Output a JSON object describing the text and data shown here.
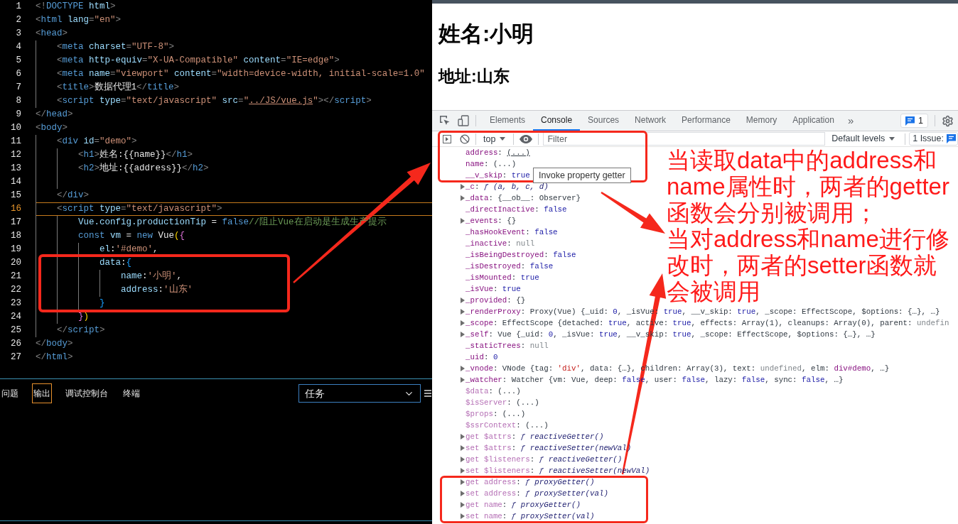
{
  "editor": {
    "lines": [
      {
        "number": "1",
        "current": false,
        "tokens": [
          {
            "text": "<!",
            "kind": "punct"
          },
          {
            "text": "DOCTYPE",
            "kind": "tag"
          },
          {
            "text": " html",
            "kind": "attr"
          },
          {
            "text": ">",
            "kind": "punct"
          }
        ]
      },
      {
        "number": "2",
        "current": false,
        "tokens": [
          {
            "text": "<",
            "kind": "punct"
          },
          {
            "text": "html",
            "kind": "tag"
          },
          {
            "text": " lang",
            "kind": "attr"
          },
          {
            "text": "=",
            "kind": "punct"
          },
          {
            "text": "\"en\"",
            "kind": "string"
          },
          {
            "text": ">",
            "kind": "punct"
          }
        ]
      },
      {
        "number": "3",
        "current": false,
        "tokens": [
          {
            "text": "<",
            "kind": "punct"
          },
          {
            "text": "head",
            "kind": "tag"
          },
          {
            "text": ">",
            "kind": "punct"
          }
        ],
        "children": [
          {
            "number": "4",
            "current": false,
            "tokens": [
              {
                "text": "<",
                "kind": "punct"
              },
              {
                "text": "meta",
                "kind": "tag"
              },
              {
                "text": " charset",
                "kind": "attr"
              },
              {
                "text": "=",
                "kind": "punct"
              },
              {
                "text": "\"UTF-8\"",
                "kind": "string"
              },
              {
                "text": ">",
                "kind": "punct"
              }
            ]
          },
          {
            "number": "5",
            "current": false,
            "tokens": [
              {
                "text": "<",
                "kind": "punct"
              },
              {
                "text": "meta",
                "kind": "tag"
              },
              {
                "text": " http-equiv",
                "kind": "attr"
              },
              {
                "text": "=",
                "kind": "punct"
              },
              {
                "text": "\"X-UA-Compatible\"",
                "kind": "string"
              },
              {
                "text": " content",
                "kind": "attr"
              },
              {
                "text": "=",
                "kind": "punct"
              },
              {
                "text": "\"IE=edge\"",
                "kind": "string"
              },
              {
                "text": ">",
                "kind": "punct"
              }
            ]
          },
          {
            "number": "6",
            "current": false,
            "tokens": [
              {
                "text": "<",
                "kind": "punct"
              },
              {
                "text": "meta",
                "kind": "tag"
              },
              {
                "text": " name",
                "kind": "attr"
              },
              {
                "text": "=",
                "kind": "punct"
              },
              {
                "text": "\"viewport\"",
                "kind": "string"
              },
              {
                "text": " content",
                "kind": "attr"
              },
              {
                "text": "=",
                "kind": "punct"
              },
              {
                "text": "\"width=device-width, initial-scale=1.0\"",
                "kind": "string"
              }
            ]
          },
          {
            "number": "7",
            "current": false,
            "tokens": [
              {
                "text": "<",
                "kind": "punct"
              },
              {
                "text": "title",
                "kind": "tag"
              },
              {
                "text": ">",
                "kind": "punct"
              },
              {
                "text": "数据代理1",
                "kind": "text"
              },
              {
                "text": "</",
                "kind": "punct"
              },
              {
                "text": "title",
                "kind": "tag"
              },
              {
                "text": ">",
                "kind": "punct"
              }
            ]
          },
          {
            "number": "8",
            "current": false,
            "tokens": [
              {
                "text": "<",
                "kind": "punct"
              },
              {
                "text": "script",
                "kind": "tag"
              },
              {
                "text": " type",
                "kind": "attr"
              },
              {
                "text": "=",
                "kind": "punct"
              },
              {
                "text": "\"text/javascript\"",
                "kind": "string"
              },
              {
                "text": " src",
                "kind": "attr"
              },
              {
                "text": "=",
                "kind": "punct"
              },
              {
                "text": "\"",
                "kind": "string"
              },
              {
                "text": "../JS/vue.js",
                "kind": "link"
              },
              {
                "text": "\"",
                "kind": "string"
              },
              {
                "text": "></",
                "kind": "punct"
              },
              {
                "text": "script",
                "kind": "tag"
              },
              {
                "text": ">",
                "kind": "punct"
              }
            ]
          }
        ]
      },
      {
        "number": "9",
        "current": false,
        "tokens": [
          {
            "text": "</",
            "kind": "punct"
          },
          {
            "text": "head",
            "kind": "tag"
          },
          {
            "text": ">",
            "kind": "punct"
          }
        ]
      },
      {
        "number": "10",
        "current": false,
        "tokens": [
          {
            "text": "<",
            "kind": "punct"
          },
          {
            "text": "body",
            "kind": "tag"
          },
          {
            "text": ">",
            "kind": "punct"
          }
        ],
        "children": [
          {
            "number": "11",
            "current": false,
            "tokens": [
              {
                "text": "<",
                "kind": "punct"
              },
              {
                "text": "div",
                "kind": "tag"
              },
              {
                "text": " id",
                "kind": "attr"
              },
              {
                "text": "=",
                "kind": "punct"
              },
              {
                "text": "\"demo\"",
                "kind": "string"
              },
              {
                "text": ">",
                "kind": "punct"
              }
            ],
            "children": [
              {
                "number": "12",
                "current": false,
                "tokens": [
                  {
                    "text": "<",
                    "kind": "punct"
                  },
                  {
                    "text": "h1",
                    "kind": "tag"
                  },
                  {
                    "text": ">",
                    "kind": "punct"
                  },
                  {
                    "text": "姓名:{{name}}",
                    "kind": "text"
                  },
                  {
                    "text": "</",
                    "kind": "punct"
                  },
                  {
                    "text": "h1",
                    "kind": "tag"
                  },
                  {
                    "text": ">",
                    "kind": "punct"
                  }
                ]
              },
              {
                "number": "13",
                "current": false,
                "tokens": [
                  {
                    "text": "<",
                    "kind": "punct"
                  },
                  {
                    "text": "h2",
                    "kind": "tag"
                  },
                  {
                    "text": ">",
                    "kind": "punct"
                  },
                  {
                    "text": "地址:{{address}}",
                    "kind": "text"
                  },
                  {
                    "text": "</",
                    "kind": "punct"
                  },
                  {
                    "text": "h2",
                    "kind": "tag"
                  },
                  {
                    "text": ">",
                    "kind": "punct"
                  }
                ]
              },
              {
                "number": "14",
                "current": false
              }
            ]
          },
          {
            "number": "15",
            "current": false,
            "tokens": [
              {
                "text": "</",
                "kind": "punct"
              },
              {
                "text": "div",
                "kind": "tag"
              },
              {
                "text": ">",
                "kind": "punct"
              }
            ]
          },
          {
            "number": "16",
            "current": true,
            "tokens": [
              {
                "text": "<",
                "kind": "punct"
              },
              {
                "text": "script",
                "kind": "tag"
              },
              {
                "text": " type",
                "kind": "attr"
              },
              {
                "text": "=",
                "kind": "punct"
              },
              {
                "text": "\"text/javascript\"",
                "kind": "string"
              },
              {
                "text": ">",
                "kind": "punct"
              }
            ],
            "children": [
              {
                "number": "17",
                "current": false,
                "tokens": [
                  {
                    "text": "Vue.config.productionTip",
                    "kind": "variable"
                  },
                  {
                    "text": " = ",
                    "kind": "text"
                  },
                  {
                    "text": "false",
                    "kind": "keyword"
                  },
                  {
                    "text": "//阻止Vue在启动是生成生产提示",
                    "kind": "comment"
                  }
                ]
              },
              {
                "number": "18",
                "current": false,
                "tokens": [
                  {
                    "text": "const",
                    "kind": "keyword"
                  },
                  {
                    "text": " vm",
                    "kind": "variable"
                  },
                  {
                    "text": " = ",
                    "kind": "text"
                  },
                  {
                    "text": "new",
                    "kind": "keyword"
                  },
                  {
                    "text": " Vue",
                    "kind": "text"
                  },
                  {
                    "text": "(",
                    "kind": "bracket-gold"
                  },
                  {
                    "text": "{",
                    "kind": "bracket-pink"
                  }
                ],
                "children": [
                  {
                    "number": "19",
                    "current": false,
                    "tokens": [
                      {
                        "text": "el",
                        "kind": "variable"
                      },
                      {
                        "text": ":",
                        "kind": "text"
                      },
                      {
                        "text": "'#demo'",
                        "kind": "string"
                      },
                      {
                        "text": ",",
                        "kind": "text"
                      }
                    ]
                  },
                  {
                    "number": "20",
                    "current": false,
                    "tokens": [
                      {
                        "text": "data",
                        "kind": "variable"
                      },
                      {
                        "text": ":",
                        "kind": "text"
                      },
                      {
                        "text": "{",
                        "kind": "bracket-blue"
                      }
                    ],
                    "children": [
                      {
                        "number": "21",
                        "current": false,
                        "tokens": [
                          {
                            "text": "name",
                            "kind": "variable"
                          },
                          {
                            "text": ":",
                            "kind": "text"
                          },
                          {
                            "text": "'小明'",
                            "kind": "string"
                          },
                          {
                            "text": ",",
                            "kind": "text"
                          }
                        ]
                      },
                      {
                        "number": "22",
                        "current": false,
                        "tokens": [
                          {
                            "text": "address",
                            "kind": "variable"
                          },
                          {
                            "text": ":",
                            "kind": "text"
                          },
                          {
                            "text": "'山东'",
                            "kind": "string"
                          }
                        ]
                      }
                    ]
                  },
                  {
                    "number": "23",
                    "current": false,
                    "tokens": [
                      {
                        "text": "}",
                        "kind": "bracket-blue"
                      }
                    ]
                  }
                ]
              },
              {
                "number": "24",
                "current": false,
                "tokens": [
                  {
                    "text": "}",
                    "kind": "bracket-pink"
                  },
                  {
                    "text": ")",
                    "kind": "bracket-gold"
                  }
                ]
              }
            ]
          },
          {
            "number": "25",
            "current": false,
            "tokens": [
              {
                "text": "</",
                "kind": "punct"
              },
              {
                "text": "script",
                "kind": "tag"
              },
              {
                "text": ">",
                "kind": "punct"
              }
            ]
          }
        ]
      },
      {
        "number": "26",
        "current": false,
        "tokens": [
          {
            "text": "</",
            "kind": "punct"
          },
          {
            "text": "body",
            "kind": "tag"
          },
          {
            "text": ">",
            "kind": "punct"
          }
        ]
      },
      {
        "number": "27",
        "current": false,
        "tokens": [
          {
            "text": "</",
            "kind": "punct"
          },
          {
            "text": "html",
            "kind": "tag"
          },
          {
            "text": ">",
            "kind": "punct"
          }
        ]
      }
    ]
  },
  "bottom_panel": {
    "tabs": [
      {
        "label": "问题",
        "selected": false
      },
      {
        "label": "输出",
        "selected": true
      },
      {
        "label": "调试控制台",
        "selected": false
      },
      {
        "label": "终端",
        "selected": false
      }
    ],
    "dropdown": {
      "value": "任务"
    }
  },
  "browser": {
    "heading": "姓名:小明",
    "subheading": "地址:山东"
  },
  "devtools": {
    "tabs": [
      {
        "label": "Elements",
        "selected": false
      },
      {
        "label": "Console",
        "selected": true
      },
      {
        "label": "Sources",
        "selected": false
      },
      {
        "label": "Network",
        "selected": false
      },
      {
        "label": "Performance",
        "selected": false
      },
      {
        "label": "Memory",
        "selected": false
      },
      {
        "label": "Application",
        "selected": false
      }
    ],
    "more_tabs": "»",
    "issues_count": "1",
    "console_toolbar": {
      "context": "top",
      "filter": {
        "placeholder": "Filter"
      },
      "levels": "Default levels",
      "issues": "1 Issue:"
    },
    "rows": [
      {
        "expandable": false,
        "tokens": [
          {
            "text": "address",
            "kind": "key"
          },
          {
            "text": ": ",
            "kind": "plain"
          },
          {
            "text": "(...)",
            "kind": "hovered"
          }
        ]
      },
      {
        "expandable": false,
        "tokens": [
          {
            "text": "name",
            "kind": "key"
          },
          {
            "text": ": (...)",
            "kind": "plain"
          }
        ]
      },
      {
        "expandable": false,
        "tokens": [
          {
            "text": "__v_skip",
            "kind": "key"
          },
          {
            "text": ": ",
            "kind": "plain"
          },
          {
            "text": "true",
            "kind": "value"
          }
        ]
      },
      {
        "expandable": true,
        "tokens": [
          {
            "text": "_c",
            "kind": "key"
          },
          {
            "text": ": ",
            "kind": "plain"
          },
          {
            "text": "ƒ (a, b, c, d)",
            "kind": "func"
          }
        ]
      },
      {
        "expandable": true,
        "tokens": [
          {
            "text": "_data",
            "kind": "key"
          },
          {
            "text": ": {__ob__: Observer}",
            "kind": "plain"
          }
        ]
      },
      {
        "expandable": false,
        "tokens": [
          {
            "text": "_directInactive",
            "kind": "key"
          },
          {
            "text": ": ",
            "kind": "plain"
          },
          {
            "text": "false",
            "kind": "value"
          }
        ]
      },
      {
        "expandable": true,
        "tokens": [
          {
            "text": "_events",
            "kind": "key"
          },
          {
            "text": ": {}",
            "kind": "plain"
          }
        ]
      },
      {
        "expandable": false,
        "tokens": [
          {
            "text": "_hasHookEvent",
            "kind": "key"
          },
          {
            "text": ": ",
            "kind": "plain"
          },
          {
            "text": "false",
            "kind": "value"
          }
        ]
      },
      {
        "expandable": false,
        "tokens": [
          {
            "text": "_inactive",
            "kind": "key"
          },
          {
            "text": ": ",
            "kind": "plain"
          },
          {
            "text": "null",
            "kind": "null"
          }
        ]
      },
      {
        "expandable": false,
        "tokens": [
          {
            "text": "_isBeingDestroyed",
            "kind": "key"
          },
          {
            "text": ": ",
            "kind": "plain"
          },
          {
            "text": "false",
            "kind": "value"
          }
        ]
      },
      {
        "expandable": false,
        "tokens": [
          {
            "text": "_isDestroyed",
            "kind": "key"
          },
          {
            "text": ": ",
            "kind": "plain"
          },
          {
            "text": "false",
            "kind": "value"
          }
        ]
      },
      {
        "expandable": false,
        "tokens": [
          {
            "text": "_isMounted",
            "kind": "key"
          },
          {
            "text": ": ",
            "kind": "plain"
          },
          {
            "text": "true",
            "kind": "value"
          }
        ]
      },
      {
        "expandable": false,
        "tokens": [
          {
            "text": "_isVue",
            "kind": "key"
          },
          {
            "text": ": ",
            "kind": "plain"
          },
          {
            "text": "true",
            "kind": "value"
          }
        ]
      },
      {
        "expandable": true,
        "tokens": [
          {
            "text": "_provided",
            "kind": "key"
          },
          {
            "text": ": {}",
            "kind": "plain"
          }
        ]
      },
      {
        "expandable": true,
        "tokens": [
          {
            "text": "_renderProxy",
            "kind": "key"
          },
          {
            "text": ": Proxy(Vue) {_uid: ",
            "kind": "plain"
          },
          {
            "text": "0",
            "kind": "value"
          },
          {
            "text": ", _isVue: ",
            "kind": "plain"
          },
          {
            "text": "true",
            "kind": "value"
          },
          {
            "text": ", __v_skip: ",
            "kind": "plain"
          },
          {
            "text": "true",
            "kind": "value"
          },
          {
            "text": ", _scope: EffectScope, $options: {…}, …}",
            "kind": "plain"
          }
        ]
      },
      {
        "expandable": true,
        "tokens": [
          {
            "text": "_scope",
            "kind": "key"
          },
          {
            "text": ": EffectScope {detached: ",
            "kind": "plain"
          },
          {
            "text": "true",
            "kind": "value"
          },
          {
            "text": ", active: ",
            "kind": "plain"
          },
          {
            "text": "true",
            "kind": "value"
          },
          {
            "text": ", effects: Array(1), cleanups: Array(0), parent: ",
            "kind": "plain"
          },
          {
            "text": "undefin",
            "kind": "null"
          }
        ]
      },
      {
        "expandable": true,
        "tokens": [
          {
            "text": "_self",
            "kind": "key"
          },
          {
            "text": ": Vue {_uid: ",
            "kind": "plain"
          },
          {
            "text": "0",
            "kind": "value"
          },
          {
            "text": ", _isVue: ",
            "kind": "plain"
          },
          {
            "text": "true",
            "kind": "value"
          },
          {
            "text": ", __v_skip: ",
            "kind": "plain"
          },
          {
            "text": "true",
            "kind": "value"
          },
          {
            "text": ", _scope: EffectScope, $options: {…}, …}",
            "kind": "plain"
          }
        ]
      },
      {
        "expandable": false,
        "tokens": [
          {
            "text": "_staticTrees",
            "kind": "key"
          },
          {
            "text": ": ",
            "kind": "plain"
          },
          {
            "text": "null",
            "kind": "null"
          }
        ]
      },
      {
        "expandable": false,
        "tokens": [
          {
            "text": "_uid",
            "kind": "key"
          },
          {
            "text": ": ",
            "kind": "plain"
          },
          {
            "text": "0",
            "kind": "value"
          }
        ]
      },
      {
        "expandable": true,
        "tokens": [
          {
            "text": "_vnode",
            "kind": "key"
          },
          {
            "text": ": VNode {tag: ",
            "kind": "plain"
          },
          {
            "text": "'div'",
            "kind": "string"
          },
          {
            "text": ", data: {…}, children: Array(3), text: ",
            "kind": "plain"
          },
          {
            "text": "undefined",
            "kind": "null"
          },
          {
            "text": ", elm: ",
            "kind": "plain"
          },
          {
            "text": "div#demo",
            "kind": "node"
          },
          {
            "text": ", …}",
            "kind": "plain"
          }
        ]
      },
      {
        "expandable": true,
        "tokens": [
          {
            "text": "_watcher",
            "kind": "key"
          },
          {
            "text": ": Watcher {vm: Vue, deep: ",
            "kind": "plain"
          },
          {
            "text": "false",
            "kind": "value"
          },
          {
            "text": ", user: ",
            "kind": "plain"
          },
          {
            "text": "false",
            "kind": "value"
          },
          {
            "text": ", lazy: ",
            "kind": "plain"
          },
          {
            "text": "false",
            "kind": "value"
          },
          {
            "text": ", sync: ",
            "kind": "plain"
          },
          {
            "text": "false",
            "kind": "value"
          },
          {
            "text": ", …}",
            "kind": "plain"
          }
        ]
      },
      {
        "expandable": false,
        "tokens": [
          {
            "text": "$data",
            "kind": "key-dim"
          },
          {
            "text": ": (...)",
            "kind": "plain"
          }
        ]
      },
      {
        "expandable": false,
        "tokens": [
          {
            "text": "$isServer",
            "kind": "key-dim"
          },
          {
            "text": ": (...)",
            "kind": "plain"
          }
        ]
      },
      {
        "expandable": false,
        "tokens": [
          {
            "text": "$props",
            "kind": "key-dim"
          },
          {
            "text": ": (...)",
            "kind": "plain"
          }
        ]
      },
      {
        "expandable": false,
        "tokens": [
          {
            "text": "$ssrContext",
            "kind": "key-dim"
          },
          {
            "text": ": (...)",
            "kind": "plain"
          }
        ]
      },
      {
        "expandable": true,
        "tokens": [
          {
            "text": "get $attrs",
            "kind": "key-dim"
          },
          {
            "text": ": ",
            "kind": "plain"
          },
          {
            "text": "ƒ reactiveGetter()",
            "kind": "func"
          }
        ]
      },
      {
        "expandable": true,
        "tokens": [
          {
            "text": "set $attrs",
            "kind": "key-dim"
          },
          {
            "text": ": ",
            "kind": "plain"
          },
          {
            "text": "ƒ reactiveSetter(newVal)",
            "kind": "func"
          }
        ]
      },
      {
        "expandable": true,
        "tokens": [
          {
            "text": "get $listeners",
            "kind": "key-dim"
          },
          {
            "text": ": ",
            "kind": "plain"
          },
          {
            "text": "ƒ reactiveGetter()",
            "kind": "func"
          }
        ]
      },
      {
        "expandable": true,
        "tokens": [
          {
            "text": "set $listeners",
            "kind": "key-dim"
          },
          {
            "text": ": ",
            "kind": "plain"
          },
          {
            "text": "ƒ reactiveSetter(newVal)",
            "kind": "func"
          }
        ]
      },
      {
        "expandable": true,
        "tokens": [
          {
            "text": "get address",
            "kind": "key-dim"
          },
          {
            "text": ": ",
            "kind": "plain"
          },
          {
            "text": "ƒ proxyGetter()",
            "kind": "func"
          }
        ]
      },
      {
        "expandable": true,
        "tokens": [
          {
            "text": "set address",
            "kind": "key-dim"
          },
          {
            "text": ": ",
            "kind": "plain"
          },
          {
            "text": "ƒ proxySetter(val)",
            "kind": "func"
          }
        ]
      },
      {
        "expandable": true,
        "tokens": [
          {
            "text": "get name",
            "kind": "key-dim"
          },
          {
            "text": ": ",
            "kind": "plain"
          },
          {
            "text": "ƒ proxyGetter()",
            "kind": "func"
          }
        ]
      },
      {
        "expandable": true,
        "tokens": [
          {
            "text": "set name",
            "kind": "key-dim"
          },
          {
            "text": ": ",
            "kind": "plain"
          },
          {
            "text": "ƒ proxySetter(val)",
            "kind": "func"
          }
        ]
      }
    ],
    "tooltip": "Invoke property getter"
  },
  "annotation": {
    "paragraphs": [
      "当读取data中的address和name属性时，两者的getter函数会分别被调用；",
      "当对address和name进行修改时，两者的setter函数就会被调用"
    ]
  }
}
